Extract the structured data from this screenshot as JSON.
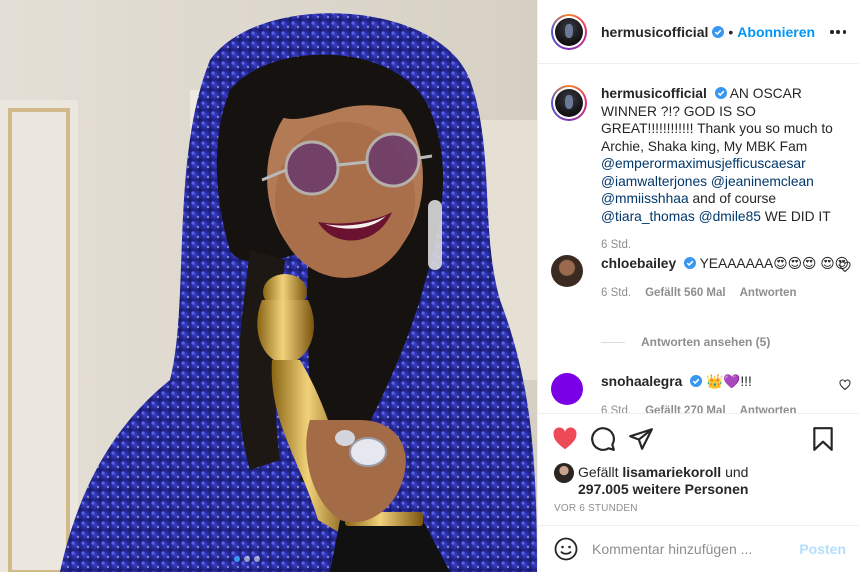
{
  "post": {
    "username": "hermusicofficial",
    "follow_label": "Abonnieren",
    "separator": "•",
    "caption_lines": [
      "AN OSCAR WINNER",
      "?!? GOD IS SO GREAT!!!!!!!!!!!! Thank you",
      "so much to Archie, Shaka king, My MBK",
      "Fam"
    ],
    "caption_mentions": [
      "@emperormaximusjefficuscaesar",
      "@iamwalterjones",
      "@jeaninemclean",
      "@mmiisshhaa",
      "@tiara_thomas",
      "@dmile85"
    ],
    "caption_text_and_course": "and of course",
    "caption_end": "WE DID IT",
    "time": "6 Std."
  },
  "comments": [
    {
      "username": "chloebailey",
      "text": "YEAAAAAA😍😍😍",
      "text2": "😍😍",
      "time": "6 Std.",
      "likes": "Gefällt 560 Mal",
      "reply": "Antworten",
      "view_replies": "Antworten ansehen (5)",
      "avatar_color": "#6b4a3a"
    },
    {
      "username": "snohaalegra",
      "text": "👑💜!!!",
      "time": "6 Std.",
      "likes": "Gefällt 270 Mal",
      "reply": "Antworten",
      "avatar_color": "#7a00e6"
    }
  ],
  "footer": {
    "liked_by_prefix": "Gefällt",
    "liked_by_user": "lisamariekoroll",
    "liked_by_and": "und",
    "liked_count": "297.005 weitere Personen",
    "ago": "VOR 6 STUNDEN",
    "comment_placeholder": "Kommentar hinzufügen ...",
    "post_label": "Posten"
  },
  "colors": {
    "accent": "#0095f6",
    "heart": "#ed4956",
    "dress": "#2a2fa8",
    "oscar_gold": "#c99a2e"
  },
  "icons": [
    "verified-icon",
    "more-options-icon",
    "heart-icon",
    "comment-icon",
    "share-icon",
    "bookmark-icon",
    "smile-icon"
  ]
}
